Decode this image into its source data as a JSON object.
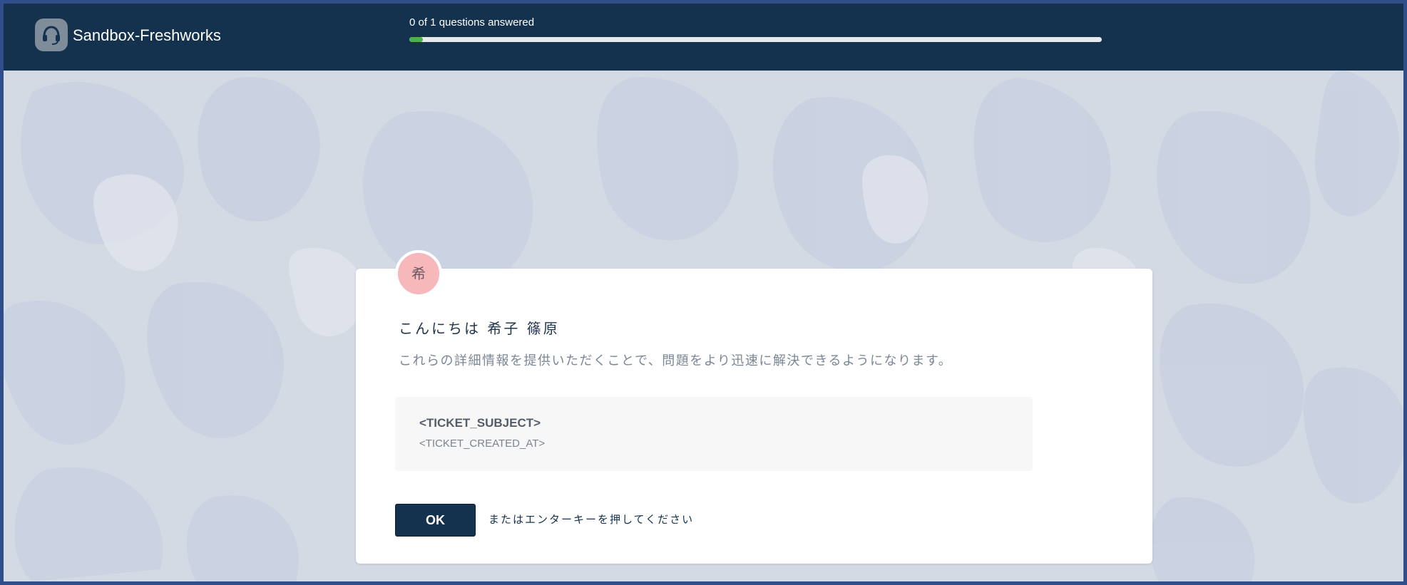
{
  "header": {
    "brand_name": "Sandbox-Freshworks",
    "logo_icon": "headset-icon",
    "progress_text": "0 of 1 questions answered",
    "progress": {
      "answered": 0,
      "total": 1,
      "fill_color": "#4caf50"
    },
    "background_color": "#14324d"
  },
  "card": {
    "avatar_initial": "希",
    "avatar_color": "#f7b8bc",
    "greeting": "こんにちは 希子 篠原",
    "subtext": "これらの詳細情報を提供いただくことで、問題をより迅速に解決できるようになります。",
    "ticket": {
      "subject": "<TICKET_SUBJECT>",
      "created_at": "<TICKET_CREATED_AT>"
    },
    "ok_label": "OK",
    "enter_hint": "またはエンターキーを押してください"
  }
}
